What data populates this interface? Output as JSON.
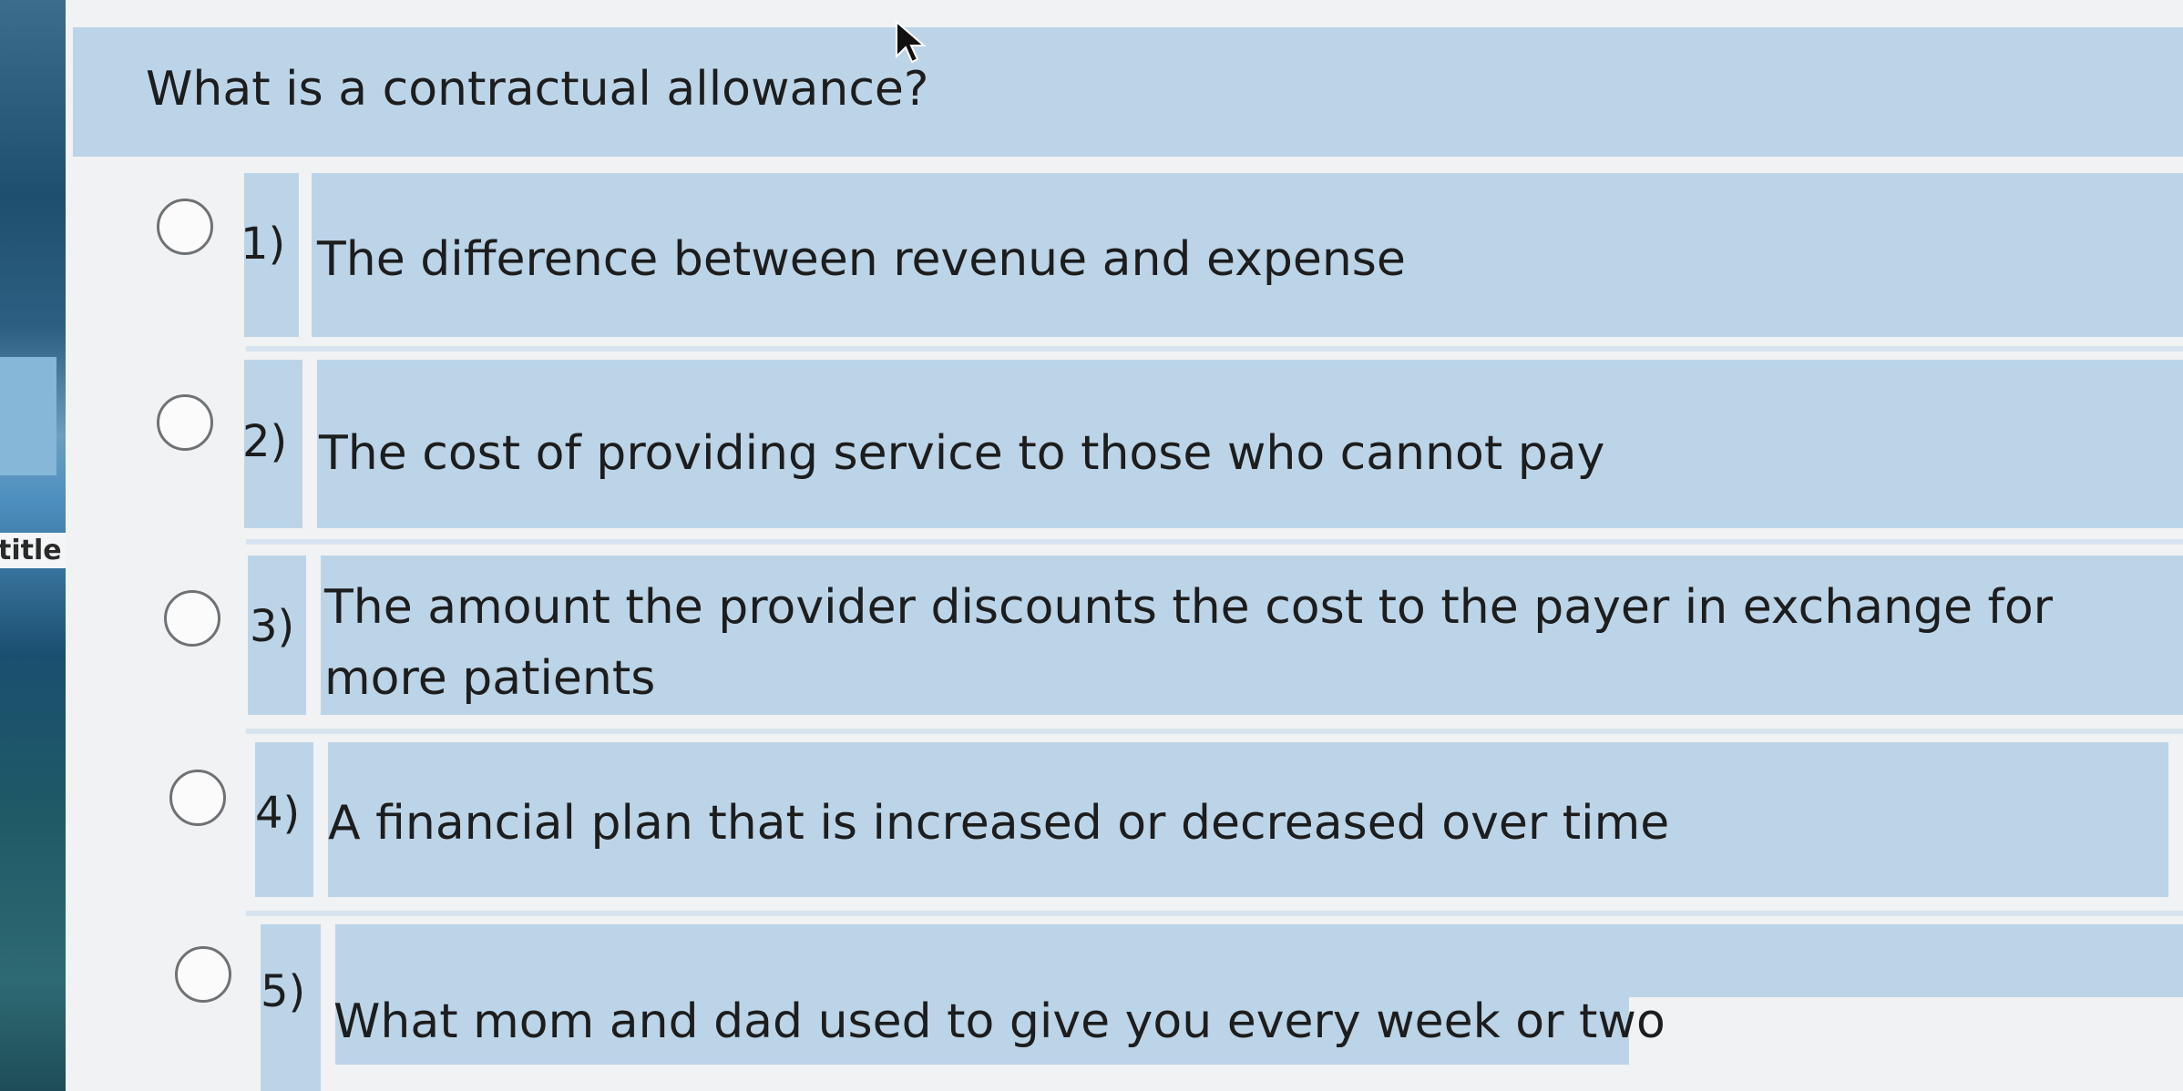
{
  "sidebar": {
    "tab_label": "title"
  },
  "question": {
    "text": "What is a contractual allowance?"
  },
  "options": [
    {
      "number": "1)",
      "text": "The difference between revenue and expense"
    },
    {
      "number": "2)",
      "text": "The cost of providing service to those who cannot pay"
    },
    {
      "number": "3)",
      "text_line1": "The amount the provider discounts the cost to the payer in exchange for",
      "text_line2": "more patients"
    },
    {
      "number": "4)",
      "text": "A financial plan that is increased or decreased over time"
    },
    {
      "number": "5)",
      "text": "What mom and dad used to give you every week or two"
    }
  ],
  "colors": {
    "panel": "#bcd4e8",
    "page": "#f1f2f3",
    "text": "#1d1d1d",
    "radio_border": "#6f7275"
  }
}
